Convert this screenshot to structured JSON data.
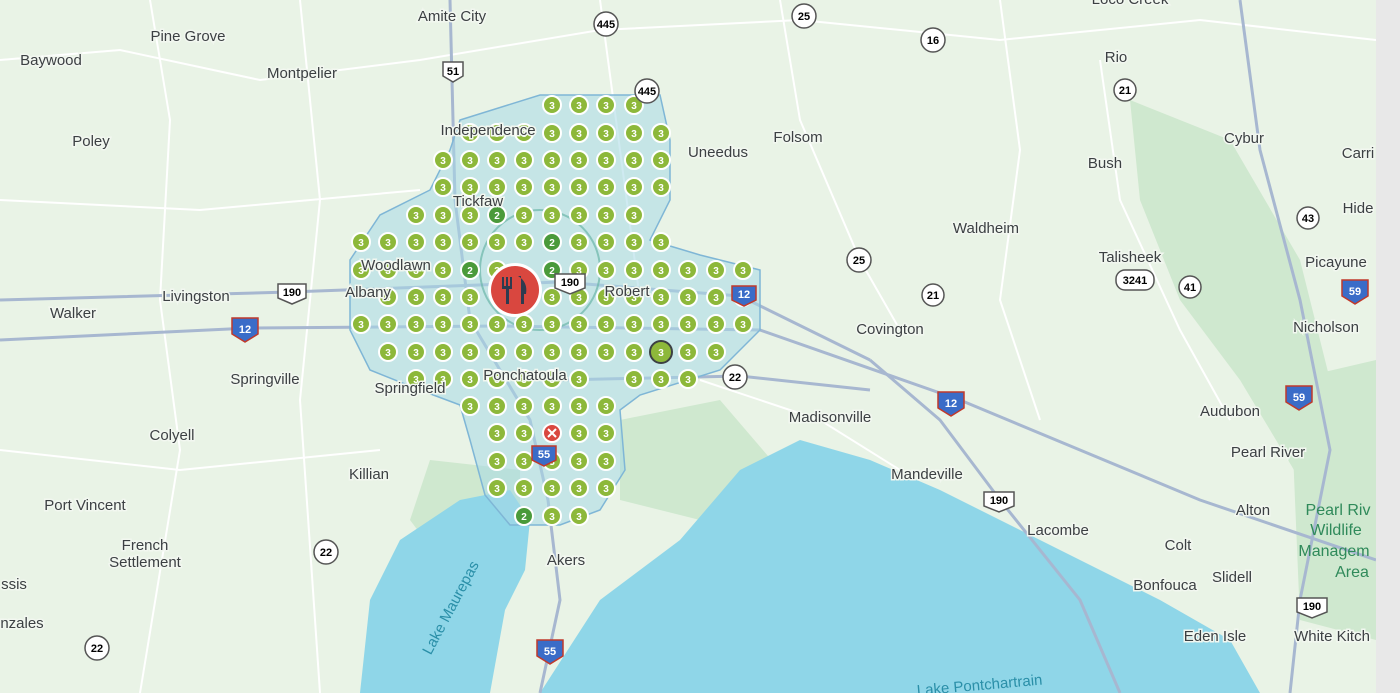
{
  "map": {
    "colors": {
      "land": "#e9f3e6",
      "forest": "#cfe8cf",
      "water": "#8fd6e8",
      "road": "#ffffff",
      "major_road": "#a7b7d0",
      "area_fill": "#a8d8e6",
      "area_stroke": "#7fb6d6",
      "point_green": "#8db83a",
      "point_dark": "#4a9a3a",
      "marker": "#d9473f"
    },
    "places": [
      {
        "name": "Amite City"
      },
      {
        "name": "Pine Grove"
      },
      {
        "name": "Baywood"
      },
      {
        "name": "Montpelier"
      },
      {
        "name": "Poley"
      },
      {
        "name": "Independence"
      },
      {
        "name": "Folsom"
      },
      {
        "name": "Uneedus"
      },
      {
        "name": "Rio"
      },
      {
        "name": "Bush"
      },
      {
        "name": "Cybur"
      },
      {
        "name": "Carri"
      },
      {
        "name": "Tickfaw"
      },
      {
        "name": "Waldheim"
      },
      {
        "name": "Talisheek"
      },
      {
        "name": "Hide"
      },
      {
        "name": "Picayune"
      },
      {
        "name": "Livingston"
      },
      {
        "name": "Albany"
      },
      {
        "name": "Walker"
      },
      {
        "name": "Robert"
      },
      {
        "name": "Covington"
      },
      {
        "name": "Nicholson"
      },
      {
        "name": "Springville"
      },
      {
        "name": "Springfield"
      },
      {
        "name": "Ponchatoula"
      },
      {
        "name": "Madisonville"
      },
      {
        "name": "Audubon"
      },
      {
        "name": "Colyell"
      },
      {
        "name": "Pearl River"
      },
      {
        "name": "Mandeville"
      },
      {
        "name": "Killian"
      },
      {
        "name": "Port Vincent"
      },
      {
        "name": "Lacombe"
      },
      {
        "name": "Alton"
      },
      {
        "name": "French"
      },
      {
        "name": "Settlement"
      },
      {
        "name": "Colt"
      },
      {
        "name": "Akers"
      },
      {
        "name": "Slidell"
      },
      {
        "name": "Bonfouca"
      },
      {
        "name": "ssis"
      },
      {
        "name": "nzales"
      },
      {
        "name": "Eden Isle"
      },
      {
        "name": "White Kitch"
      },
      {
        "name": "Woodlawn"
      },
      {
        "name": "Lake Maurepas"
      },
      {
        "name": "Pearl Riv"
      },
      {
        "name": "Wildlife"
      },
      {
        "name": "Managem"
      },
      {
        "name": "Area"
      },
      {
        "name": "Lake Pontchartrain"
      },
      {
        "name": "Loco Creek"
      }
    ],
    "shields": [
      {
        "label": "445"
      },
      {
        "label": "25"
      },
      {
        "label": "16"
      },
      {
        "label": "51"
      },
      {
        "label": "445"
      },
      {
        "label": "21"
      },
      {
        "label": "43"
      },
      {
        "label": "190"
      },
      {
        "label": "12"
      },
      {
        "label": "190"
      },
      {
        "label": "25"
      },
      {
        "label": "3241"
      },
      {
        "label": "41"
      },
      {
        "label": "21"
      },
      {
        "label": "59"
      },
      {
        "label": "22"
      },
      {
        "label": "12"
      },
      {
        "label": "59"
      },
      {
        "label": "190"
      },
      {
        "label": "190"
      },
      {
        "label": "22"
      },
      {
        "label": "55"
      },
      {
        "label": "22"
      },
      {
        "label": "55"
      },
      {
        "label": "12"
      }
    ],
    "grid_points": [],
    "special_points": [
      {
        "label": "2"
      },
      {
        "label": "2"
      },
      {
        "label": "2"
      },
      {
        "label": "2"
      },
      {
        "label": "2"
      },
      {
        "label": "3"
      }
    ],
    "restaurant_marker": {
      "icon": "fork-knife-icon"
    },
    "closed_marker": {
      "icon": "x-icon"
    }
  }
}
